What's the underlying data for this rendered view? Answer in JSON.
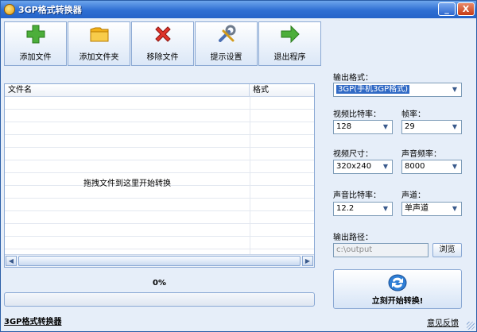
{
  "window": {
    "title": "3GP格式转换器",
    "minimize": "_",
    "close": "X"
  },
  "toolbar": {
    "add_file": "添加文件",
    "add_folder": "添加文件夹",
    "remove_file": "移除文件",
    "settings": "提示设置",
    "exit": "退出程序"
  },
  "file_list": {
    "col_name": "文件名",
    "col_format": "格式",
    "hint": "拖拽文件到这里开始转换",
    "rows": []
  },
  "progress": {
    "label": "0%",
    "value_percent": 0
  },
  "settings": {
    "output_format_label": "输出格式：",
    "output_format_value": "3GP(手机3GP格式)",
    "video_bitrate_label": "视频比特率：",
    "video_bitrate_value": "128",
    "framerate_label": "帧率：",
    "framerate_value": "29",
    "video_size_label": "视频尺寸：",
    "video_size_value": "320x240",
    "audio_freq_label": "声音频率：",
    "audio_freq_value": "8000",
    "audio_bitrate_label": "声音比特率：",
    "audio_bitrate_value": "12.2",
    "channel_label": "声道：",
    "channel_value": "单声道",
    "output_path_label": "输出路径：",
    "output_path_value": "c:\\output",
    "browse_label": "浏览"
  },
  "convert_button": {
    "label": "立刻开始转换!"
  },
  "footer": {
    "app_link": "3GP格式转换器",
    "feedback": "意见反馈"
  },
  "colors": {
    "title_bar": "#2f6fd3",
    "window_bg": "#e6eef9",
    "selection": "#316ac5"
  }
}
